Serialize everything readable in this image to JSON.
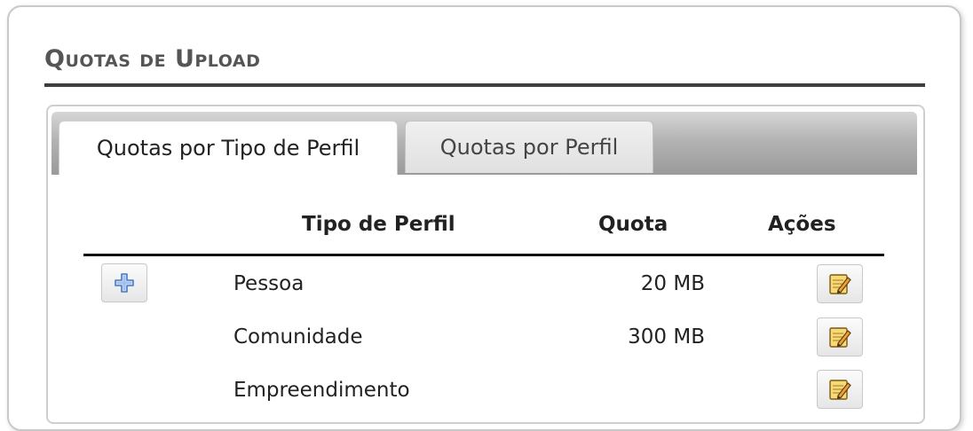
{
  "page": {
    "title": "Quotas de Upload"
  },
  "tabs": [
    {
      "label": "Quotas por Tipo de Perfil",
      "active": true
    },
    {
      "label": "Quotas por Perfil",
      "active": false
    }
  ],
  "table": {
    "headers": {
      "tipo": "Tipo de Perfil",
      "quota": "Quota",
      "acoes": "Ações"
    },
    "rows": [
      {
        "tipo": "Pessoa",
        "quota": "20 MB"
      },
      {
        "tipo": "Comunidade",
        "quota": "300 MB"
      },
      {
        "tipo": "Empreendimento",
        "quota": ""
      }
    ]
  },
  "icons": {
    "add": "plus-icon",
    "edit": "edit-note-icon"
  },
  "colors": {
    "title": "#555555",
    "plus_blue": "#4a78c0",
    "edit_yellow": "#f2c94c"
  }
}
